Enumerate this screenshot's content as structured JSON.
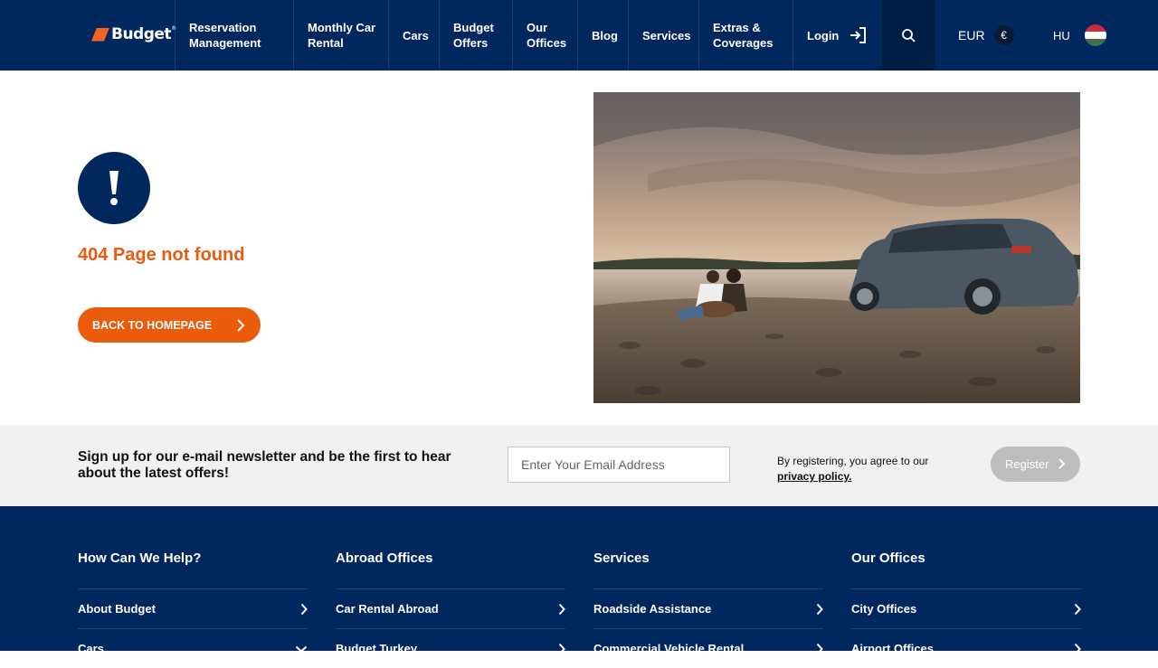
{
  "brand": {
    "name": "Budget",
    "mark": "®"
  },
  "nav": {
    "items": [
      {
        "label": "Reservation\nManagement"
      },
      {
        "label": "Monthly Car\nRental"
      },
      {
        "label": "Cars"
      },
      {
        "label": "Budget\nOffers"
      },
      {
        "label": "Our\nOffices"
      },
      {
        "label": "Blog"
      },
      {
        "label": "Services"
      },
      {
        "label": "Extras &\nCoverages"
      }
    ],
    "login_label": "Login",
    "currency_label": "EUR",
    "currency_symbol": "€",
    "language_label": "HU"
  },
  "error": {
    "title": "404 Page not found",
    "back_button": "BACK TO HOMEPAGE"
  },
  "newsletter": {
    "text": "Sign up for our e-mail newsletter and be the first to hear about the latest offers!",
    "email_placeholder": "Enter Your Email Address",
    "legal_text": "By registering, you agree to our",
    "privacy_link": "privacy policy.",
    "register_button": "Register"
  },
  "footer": {
    "columns": [
      {
        "title": "How Can We Help?",
        "links": [
          "About Budget",
          "Cars"
        ]
      },
      {
        "title": "Abroad Offices",
        "links": [
          "Car Rental Abroad",
          "Budget Turkey"
        ]
      },
      {
        "title": "Services",
        "links": [
          "Roadside Assistance",
          "Commercial Vehicle Rental"
        ]
      },
      {
        "title": "Our Offices",
        "links": [
          "City Offices",
          "Airport Offices"
        ]
      }
    ]
  },
  "colors": {
    "navy": "#00285f",
    "orange": "#ea5b0c",
    "newsletter_bg": "#f1f1f1",
    "register_disabled": "#bdbdbd"
  }
}
